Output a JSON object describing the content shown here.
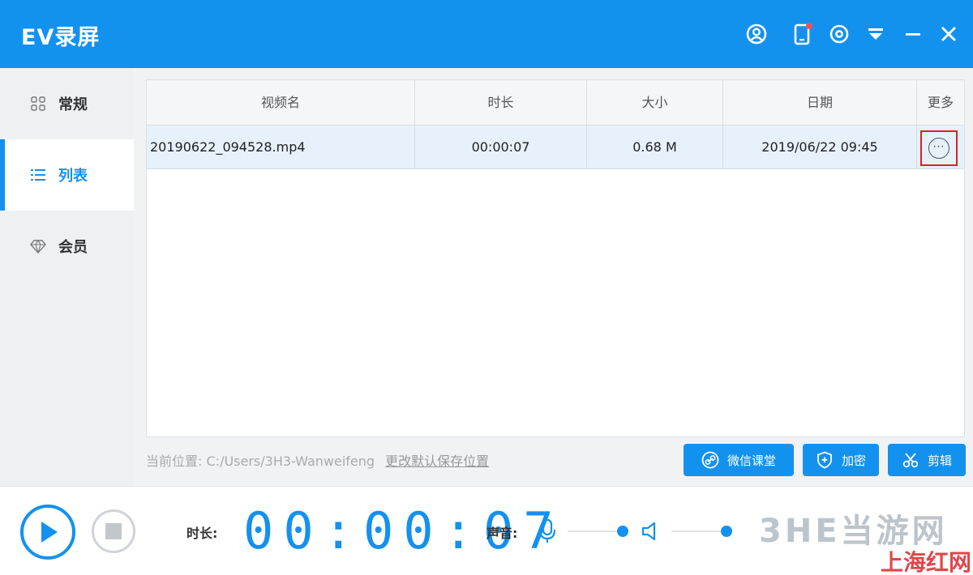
{
  "app": {
    "title": "EV录屏"
  },
  "sidebar": {
    "items": [
      {
        "label": "常规",
        "icon": "grid-icon"
      },
      {
        "label": "列表",
        "icon": "list-icon",
        "active": true
      },
      {
        "label": "会员",
        "icon": "diamond-icon"
      }
    ]
  },
  "table": {
    "columns": [
      "视频名",
      "时长",
      "大小",
      "日期",
      "更多"
    ],
    "rows": [
      {
        "name": "20190622_094528.mp4",
        "duration": "00:00:07",
        "size": "0.68 M",
        "date": "2019/06/22 09:45",
        "more": "···"
      }
    ]
  },
  "path": {
    "label": "当前位置:",
    "value": "C:/Users/3H3-Wanweifeng",
    "change_link": "更改默认保存位置"
  },
  "actions": {
    "wechat": "微信课堂",
    "encrypt": "加密",
    "cut": "剪辑"
  },
  "bottom": {
    "duration_label": "时长:",
    "timer": "00:00:07",
    "sound_label": "声音:"
  },
  "watermark": {
    "brand": "3HE当游网",
    "sub": "上海红网"
  },
  "colors": {
    "accent": "#1391ef",
    "highlight_border": "#e02020"
  }
}
